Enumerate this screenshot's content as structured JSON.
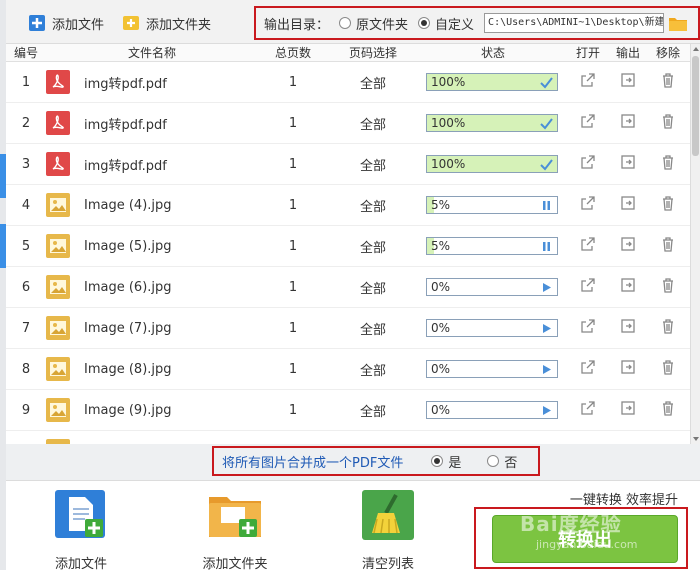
{
  "toolbar": {
    "add_file": "添加文件",
    "add_folder": "添加文件夹",
    "output_label": "输出目录：",
    "opt_original": "原文件夹",
    "opt_custom": "自定义",
    "output_path": "C:\\Users\\ADMINI~1\\Desktop\\新建文"
  },
  "table": {
    "headers": {
      "no": "编号",
      "name": "文件名称",
      "pages": "总页数",
      "select": "页码选择",
      "status": "状态",
      "open": "打开",
      "output": "输出",
      "remove": "移除"
    },
    "rows": [
      {
        "no": "1",
        "name": "img转pdf.pdf",
        "pages": "1",
        "select": "全部",
        "progress": "100%",
        "state": "done",
        "type": "pdf"
      },
      {
        "no": "2",
        "name": "img转pdf.pdf",
        "pages": "1",
        "select": "全部",
        "progress": "100%",
        "state": "done",
        "type": "pdf"
      },
      {
        "no": "3",
        "name": "img转pdf.pdf",
        "pages": "1",
        "select": "全部",
        "progress": "100%",
        "state": "done",
        "type": "pdf"
      },
      {
        "no": "4",
        "name": "Image (4).jpg",
        "pages": "1",
        "select": "全部",
        "progress": "5%",
        "state": "paused",
        "type": "img"
      },
      {
        "no": "5",
        "name": "Image (5).jpg",
        "pages": "1",
        "select": "全部",
        "progress": "5%",
        "state": "paused",
        "type": "img"
      },
      {
        "no": "6",
        "name": "Image (6).jpg",
        "pages": "1",
        "select": "全部",
        "progress": "0%",
        "state": "play",
        "type": "img"
      },
      {
        "no": "7",
        "name": "Image (7).jpg",
        "pages": "1",
        "select": "全部",
        "progress": "0%",
        "state": "play",
        "type": "img"
      },
      {
        "no": "8",
        "name": "Image (8).jpg",
        "pages": "1",
        "select": "全部",
        "progress": "0%",
        "state": "play",
        "type": "img"
      },
      {
        "no": "9",
        "name": "Image (9).jpg",
        "pages": "1",
        "select": "全部",
        "progress": "0%",
        "state": "play",
        "type": "img"
      }
    ]
  },
  "merge": {
    "text": "将所有图片合并成一个PDF文件",
    "yes": "是",
    "no": "否"
  },
  "bottom": {
    "add_file": "添加文件",
    "add_folder": "添加文件夹",
    "clear": "清空列表",
    "slogan": "一键转换  效率提升",
    "convert": "转换出"
  },
  "watermark": {
    "brand": "Bai度经验",
    "url": "jingyan.baidu.com"
  },
  "colors": {
    "accent_red": "#c9191e",
    "convert_green": "#7cc441",
    "progress_fill": "#d6f2b8",
    "merge_text": "#1f5ab5"
  }
}
